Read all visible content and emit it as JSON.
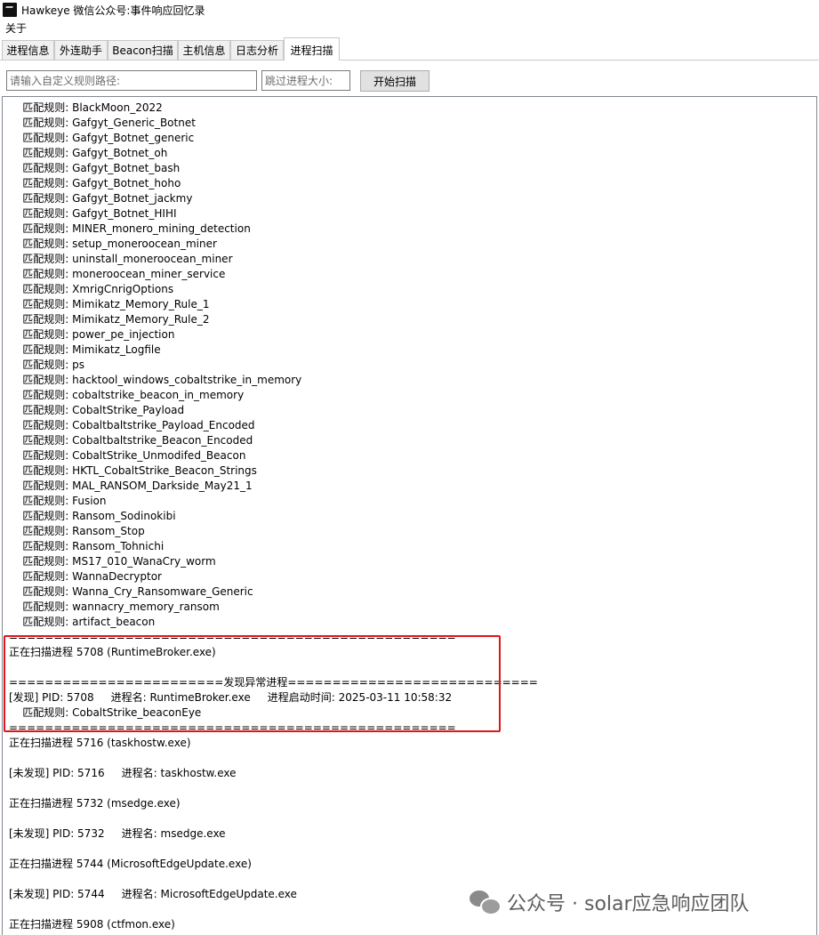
{
  "window": {
    "title": "Hawkeye 微信公众号:事件响应回忆录"
  },
  "menu": {
    "about": "关于"
  },
  "tabs": [
    {
      "label": "进程信息"
    },
    {
      "label": "外连助手"
    },
    {
      "label": "Beacon扫描"
    },
    {
      "label": "主机信息"
    },
    {
      "label": "日志分析"
    },
    {
      "label": "进程扫描",
      "active": true
    }
  ],
  "toolbar": {
    "rule_path_placeholder": "请输入自定义规则路径:",
    "skip_size_placeholder": "跳过进程大小:",
    "start_scan_label": "开始扫描"
  },
  "output_lines": [
    "    匹配规则: BlackMoon_2022",
    "    匹配规则: Gafgyt_Generic_Botnet",
    "    匹配规则: Gafgyt_Botnet_generic",
    "    匹配规则: Gafgyt_Botnet_oh",
    "    匹配规则: Gafgyt_Botnet_bash",
    "    匹配规则: Gafgyt_Botnet_hoho",
    "    匹配规则: Gafgyt_Botnet_jackmy",
    "    匹配规则: Gafgyt_Botnet_HIHI",
    "    匹配规则: MINER_monero_mining_detection",
    "    匹配规则: setup_moneroocean_miner",
    "    匹配规则: uninstall_moneroocean_miner",
    "    匹配规则: moneroocean_miner_service",
    "    匹配规则: XmrigCnrigOptions",
    "    匹配规则: Mimikatz_Memory_Rule_1",
    "    匹配规则: Mimikatz_Memory_Rule_2",
    "    匹配规则: power_pe_injection",
    "    匹配规则: Mimikatz_Logfile",
    "    匹配规则: ps",
    "    匹配规则: hacktool_windows_cobaltstrike_in_memory",
    "    匹配规则: cobaltstrike_beacon_in_memory",
    "    匹配规则: CobaltStrike_Payload",
    "    匹配规则: Cobaltbaltstrike_Payload_Encoded",
    "    匹配规则: Cobaltbaltstrike_Beacon_Encoded",
    "    匹配规则: CobaltStrike_Unmodifed_Beacon",
    "    匹配规则: HKTL_CobaltStrike_Beacon_Strings",
    "    匹配规则: MAL_RANSOM_Darkside_May21_1",
    "    匹配规则: Fusion",
    "    匹配规则: Ransom_Sodinokibi",
    "    匹配规则: Ransom_Stop",
    "    匹配规则: Ransom_Tohnichi",
    "    匹配规则: MS17_010_WanaCry_worm",
    "    匹配规则: WannaDecryptor",
    "    匹配规则: Wanna_Cry_Ransomware_Generic",
    "    匹配规则: wannacry_memory_ransom",
    "    匹配规则: artifact_beacon",
    "==================================================",
    "正在扫描进程 5708 (RuntimeBroker.exe)",
    "",
    "========================发现异常进程============================",
    "[发现] PID: 5708     进程名: RuntimeBroker.exe     进程启动时间: 2025-03-11 10:58:32",
    "    匹配规则: CobaltStrike_beaconEye",
    "==================================================",
    "正在扫描进程 5716 (taskhostw.exe)",
    "",
    "[未发现] PID: 5716     进程名: taskhostw.exe",
    "",
    "正在扫描进程 5732 (msedge.exe)",
    "",
    "[未发现] PID: 5732     进程名: msedge.exe",
    "",
    "正在扫描进程 5744 (MicrosoftEdgeUpdate.exe)",
    "",
    "[未发现] PID: 5744     进程名: MicrosoftEdgeUpdate.exe",
    "",
    "正在扫描进程 5908 (ctfmon.exe)"
  ],
  "watermark": {
    "text": "公众号 · solar应急响应团队"
  }
}
